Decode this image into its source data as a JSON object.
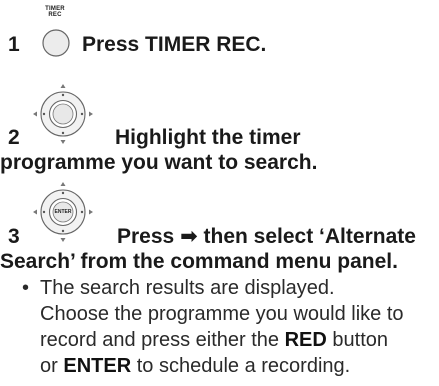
{
  "steps": [
    {
      "number": "1",
      "button_label_line1": "TIMER",
      "button_label_line2": "REC",
      "instruction": "Press TIMER REC."
    },
    {
      "number": "2",
      "instruction_line1": "Highlight the timer",
      "instruction_line2": "programme you want to search."
    },
    {
      "number": "3",
      "center_label": "ENTER",
      "instruction_prefix": "Press",
      "arrow": "➡",
      "instruction_suffix": "then select ‘Alternate",
      "instruction_line2": "Search’ from the command menu panel."
    }
  ],
  "bullet": {
    "mark": "•",
    "line1": "The search results are displayed.",
    "line2": "Choose the programme you would like to",
    "line3_before": "record and press either the",
    "line3_bold": "RED",
    "line3_after": "button",
    "line4_before": "or",
    "line4_bold": "ENTER",
    "line4_after": "to schedule a recording."
  }
}
